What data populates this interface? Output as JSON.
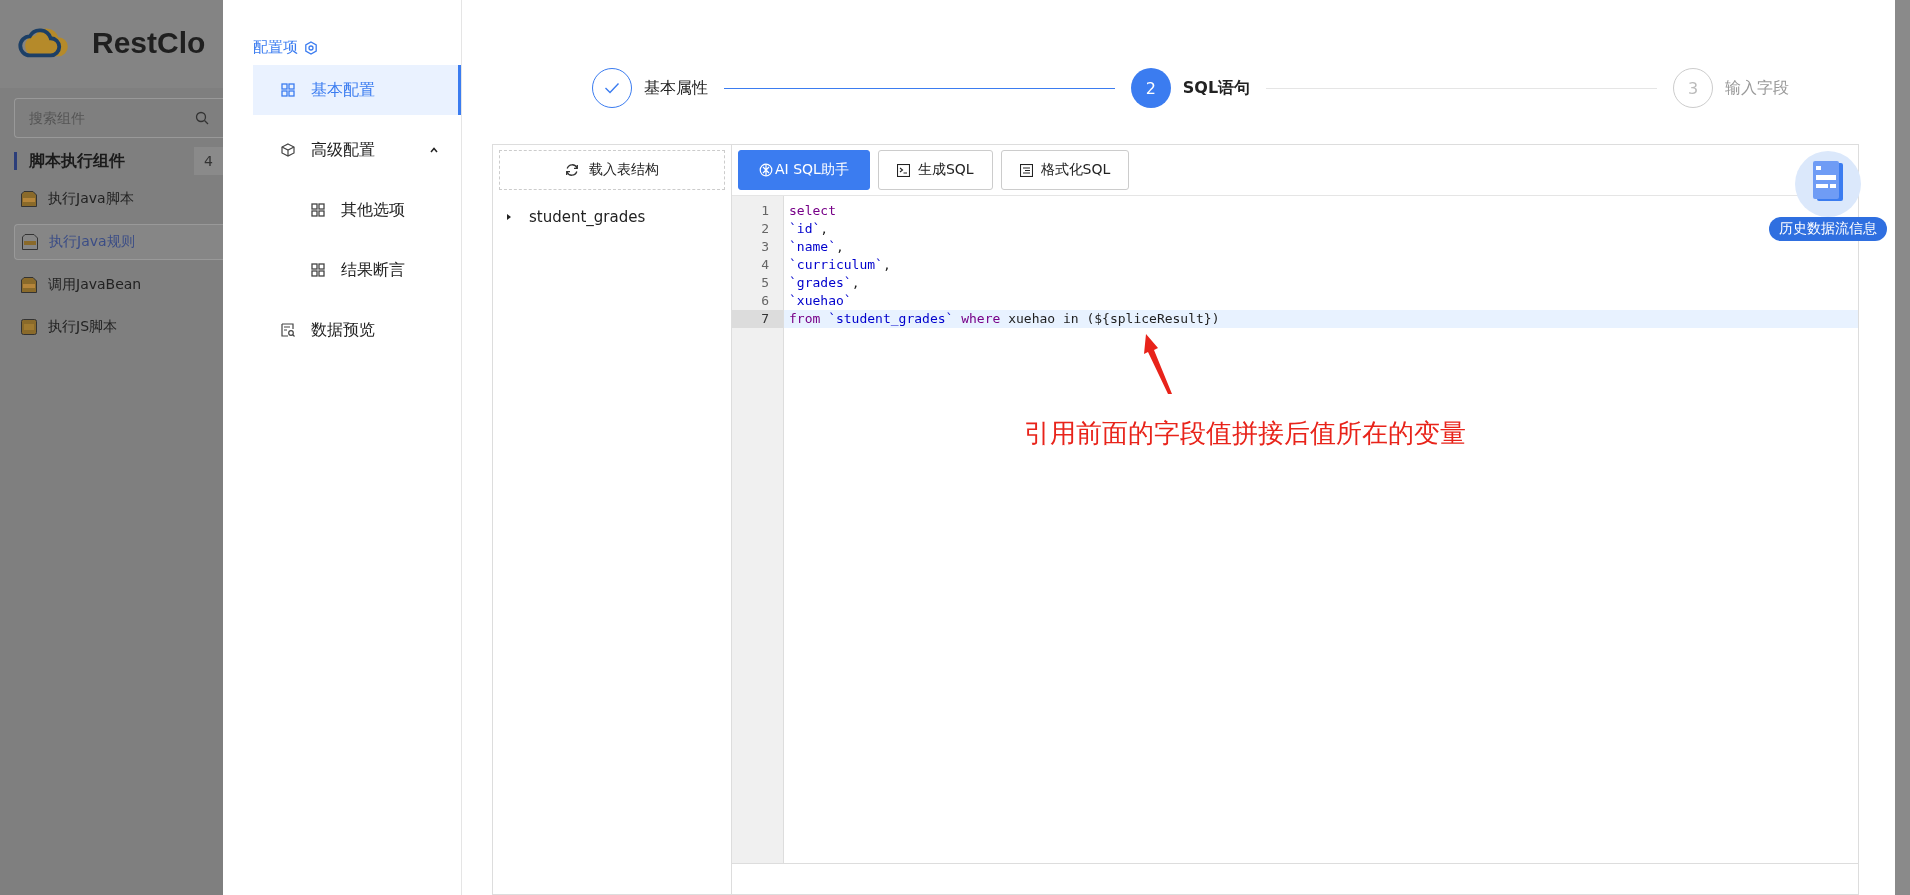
{
  "background_app": {
    "logo_text": "RestClo",
    "search": {
      "placeholder": "搜索组件"
    },
    "group": {
      "title": "脚本执行组件",
      "count": "4"
    },
    "items": [
      {
        "label": "执行Java脚本",
        "kind": "java",
        "selected": false
      },
      {
        "label": "执行Java规则",
        "kind": "rule",
        "selected": true
      },
      {
        "label": "调用JavaBean",
        "kind": "java",
        "selected": false
      },
      {
        "label": "执行JS脚本",
        "kind": "js",
        "selected": false
      }
    ]
  },
  "config_menu": {
    "title": "配置项",
    "items": [
      {
        "label": "基本配置",
        "kind": "grid",
        "selected": true
      },
      {
        "label": "高级配置",
        "kind": "cube",
        "selected": false,
        "expanded": true,
        "children": [
          {
            "label": "其他选项",
            "kind": "grid",
            "selected": false
          },
          {
            "label": "结果断言",
            "kind": "grid",
            "selected": false
          }
        ]
      },
      {
        "label": "数据预览",
        "kind": "preview",
        "selected": false
      }
    ]
  },
  "steps": [
    {
      "label": "基本属性",
      "done": true,
      "selected": false
    },
    {
      "number": "2",
      "label": "SQL语句",
      "done": false,
      "selected": true
    },
    {
      "number": "3",
      "label": "输入字段",
      "done": false,
      "selected": false
    }
  ],
  "load_button": "载入表结构",
  "tables": [
    {
      "name": "student_grades",
      "expanded": false
    }
  ],
  "toolbar": [
    {
      "label": "AI SQL助手",
      "kind": "ai",
      "primary": true
    },
    {
      "label": "生成SQL",
      "kind": "terminal",
      "primary": false
    },
    {
      "label": "格式化SQL",
      "kind": "format",
      "primary": false
    }
  ],
  "code_lines": [
    {
      "number": "1",
      "active": false,
      "tokens": [
        {
          "text": "select",
          "kind": "keyword"
        }
      ]
    },
    {
      "number": "2",
      "active": false,
      "tokens": [
        {
          "text": "`id`",
          "kind": "name"
        },
        {
          "text": ",",
          "kind": "plain"
        }
      ]
    },
    {
      "number": "3",
      "active": false,
      "tokens": [
        {
          "text": "`name`",
          "kind": "name"
        },
        {
          "text": ",",
          "kind": "plain"
        }
      ]
    },
    {
      "number": "4",
      "active": false,
      "tokens": [
        {
          "text": "`curriculum`",
          "kind": "name"
        },
        {
          "text": ",",
          "kind": "plain"
        }
      ]
    },
    {
      "number": "5",
      "active": false,
      "tokens": [
        {
          "text": "`grades`",
          "kind": "name"
        },
        {
          "text": ",",
          "kind": "plain"
        }
      ]
    },
    {
      "number": "6",
      "active": false,
      "tokens": [
        {
          "text": "`xuehao`",
          "kind": "name"
        }
      ]
    },
    {
      "number": "7",
      "active": true,
      "tokens": [
        {
          "text": "from ",
          "kind": "keyword"
        },
        {
          "text": "`student_grades` ",
          "kind": "name"
        },
        {
          "text": "where ",
          "kind": "keyword"
        },
        {
          "text": "xuehao in (${spliceResult})",
          "kind": "plain"
        }
      ]
    }
  ],
  "floating_badge": "历史数据流信息",
  "annotation": "引用前面的字段值拼接后值所在的变量"
}
